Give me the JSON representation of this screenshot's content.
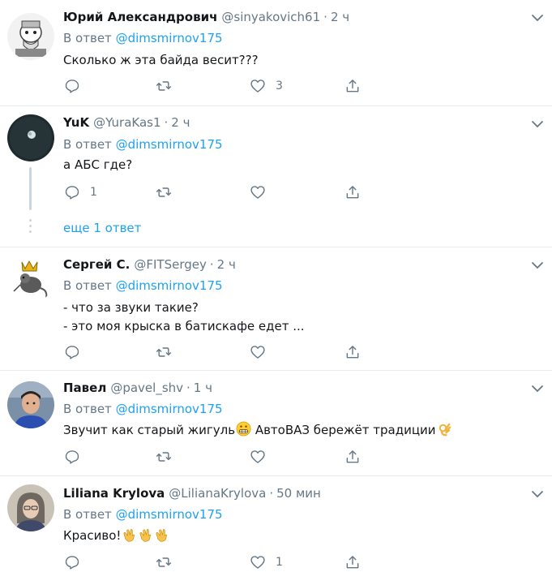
{
  "tweets": [
    {
      "name": "Юрий Александрович",
      "handle": "@sinyakovich61",
      "time": "2 ч",
      "reply_prefix": "В ответ",
      "reply_mention": "@dimsmirnov175",
      "text": "Сколько ж эта байда весит???",
      "reply_count": "",
      "retweet_count": "",
      "like_count": "3"
    },
    {
      "name": "YuK",
      "handle": "@YuraKas1",
      "time": "2 ч",
      "reply_prefix": "В ответ",
      "reply_mention": "@dimsmirnov175",
      "text": "а АБС где?",
      "reply_count": "1",
      "retweet_count": "",
      "like_count": "",
      "more_replies": "еще 1 ответ"
    },
    {
      "name": "Сергей С.",
      "handle": "@FITSergey",
      "time": "2 ч",
      "reply_prefix": "В ответ",
      "reply_mention": "@dimsmirnov175",
      "text_line1": "- что за звуки такие?",
      "text_line2": "- это моя крыска в батискафе едет ...",
      "reply_count": "",
      "retweet_count": "",
      "like_count": ""
    },
    {
      "name": "Павел",
      "handle": "@pavel_shv",
      "time": "1 ч",
      "reply_prefix": "В ответ",
      "reply_mention": "@dimsmirnov175",
      "text_part1": "Звучит как старый жигуль",
      "text_part2": " АвтоВАЗ бережёт традиции",
      "reply_count": "",
      "retweet_count": "",
      "like_count": ""
    },
    {
      "name": "Liliana Krylova",
      "handle": "@LilianaKrylova",
      "time": "50 мин",
      "reply_prefix": "В ответ",
      "reply_mention": "@dimsmirnov175",
      "text": "Красиво!",
      "reply_count": "",
      "retweet_count": "",
      "like_count": "1"
    }
  ],
  "dot_separator": "·",
  "colors": {
    "link": "#1da1f2",
    "secondary": "#657786",
    "primary_text": "#14171a",
    "divider": "#e6ecf0"
  },
  "icons": [
    "reply-icon",
    "retweet-icon",
    "like-icon",
    "share-icon",
    "chevron-down-icon"
  ]
}
